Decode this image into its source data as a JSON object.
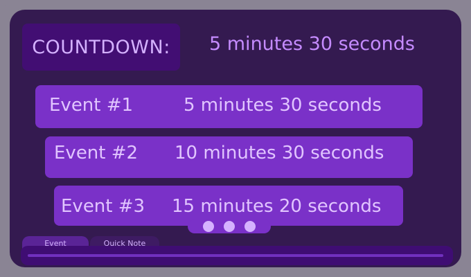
{
  "header": {
    "label": "COUNTDOWN:",
    "value": "5 minutes 30 seconds"
  },
  "events": [
    {
      "name": "Event #1",
      "time": "5 minutes 30 seconds"
    },
    {
      "name": "Event #2",
      "time": "10 minutes 30 seconds"
    },
    {
      "name": "Event #3",
      "time": "15 minutes 20 seconds"
    }
  ],
  "tabs": [
    {
      "label": "Event"
    },
    {
      "label": "Quick Note"
    }
  ],
  "pager": {
    "page_count": 3
  },
  "colors": {
    "background": "#341a50",
    "accent": "#7a31c8",
    "text": "#e1c5ff"
  }
}
